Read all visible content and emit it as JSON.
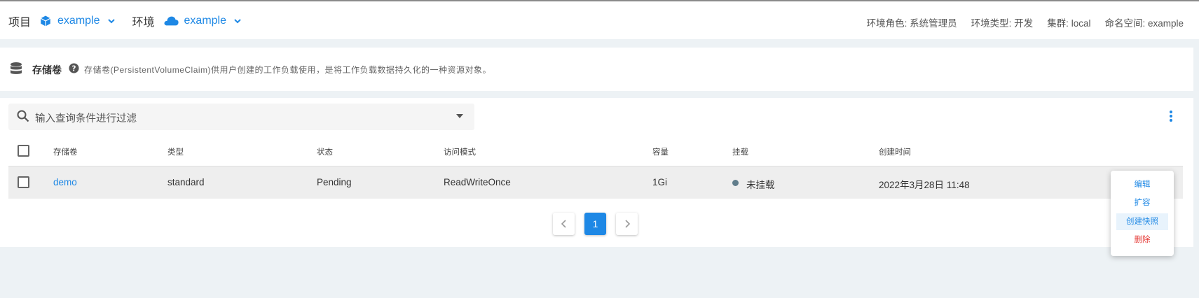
{
  "topbar": {
    "project_label": "项目",
    "project_value": "example",
    "env_label": "环境",
    "env_value": "example",
    "info": {
      "role": "环境角色: 系统管理员",
      "type": "环境类型: 开发",
      "cluster": "集群: local",
      "namespace": "命名空间: example"
    }
  },
  "description": {
    "title": "存储卷",
    "text": "存储卷(PersistentVolumeClaim)供用户创建的工作负载使用，是将工作负载数据持久化的一种资源对象。"
  },
  "filter": {
    "placeholder": "输入查询条件进行过滤"
  },
  "table": {
    "columns": [
      "存储卷",
      "类型",
      "状态",
      "访问模式",
      "容量",
      "挂载",
      "创建时间"
    ],
    "rows": [
      {
        "name": "demo",
        "type": "standard",
        "status": "Pending",
        "access_mode": "ReadWriteOnce",
        "capacity": "1Gi",
        "mount": "未挂载",
        "created": "2022年3月28日 11:48"
      }
    ]
  },
  "pagination": {
    "current_page": "1"
  },
  "row_menu": {
    "items": [
      "编辑",
      "扩容",
      "创建快照",
      "删除"
    ]
  },
  "colors": {
    "accent": "#1e88e5",
    "danger": "#e53935",
    "page_bg": "#edf2f5"
  }
}
